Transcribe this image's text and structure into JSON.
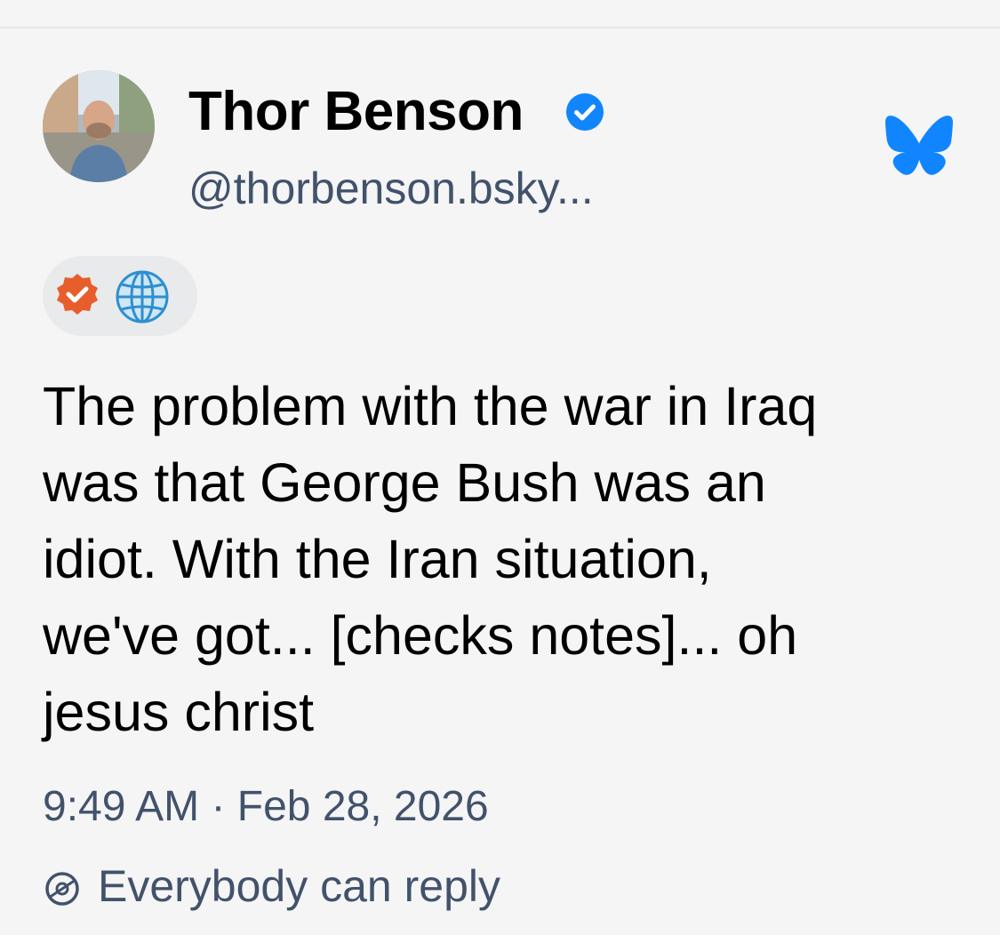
{
  "post": {
    "author": {
      "display_name": "Thor Benson",
      "handle": "@thorbenson.bsky...",
      "verified": true
    },
    "text_lines": [
      "The problem with the war in Iraq",
      "was that George Bush was an",
      "idiot. With the Iran situation,",
      "we've got... [checks notes]... oh",
      "jesus christ"
    ],
    "timestamp": "9:49 AM · Feb 28, 2026",
    "reply_setting": "Everybody can reply"
  },
  "icons": {
    "verified": "verified-check-icon",
    "app_logo": "bluesky-butterfly-icon",
    "badge_1": "orange-check-badge-icon",
    "badge_2": "globe-icon",
    "reply": "reply-setting-icon"
  },
  "colors": {
    "background": "#f5f5f6",
    "accent_blue": "#1185fe",
    "secondary_text": "#42526b",
    "badge_orange": "#e85d2c"
  }
}
